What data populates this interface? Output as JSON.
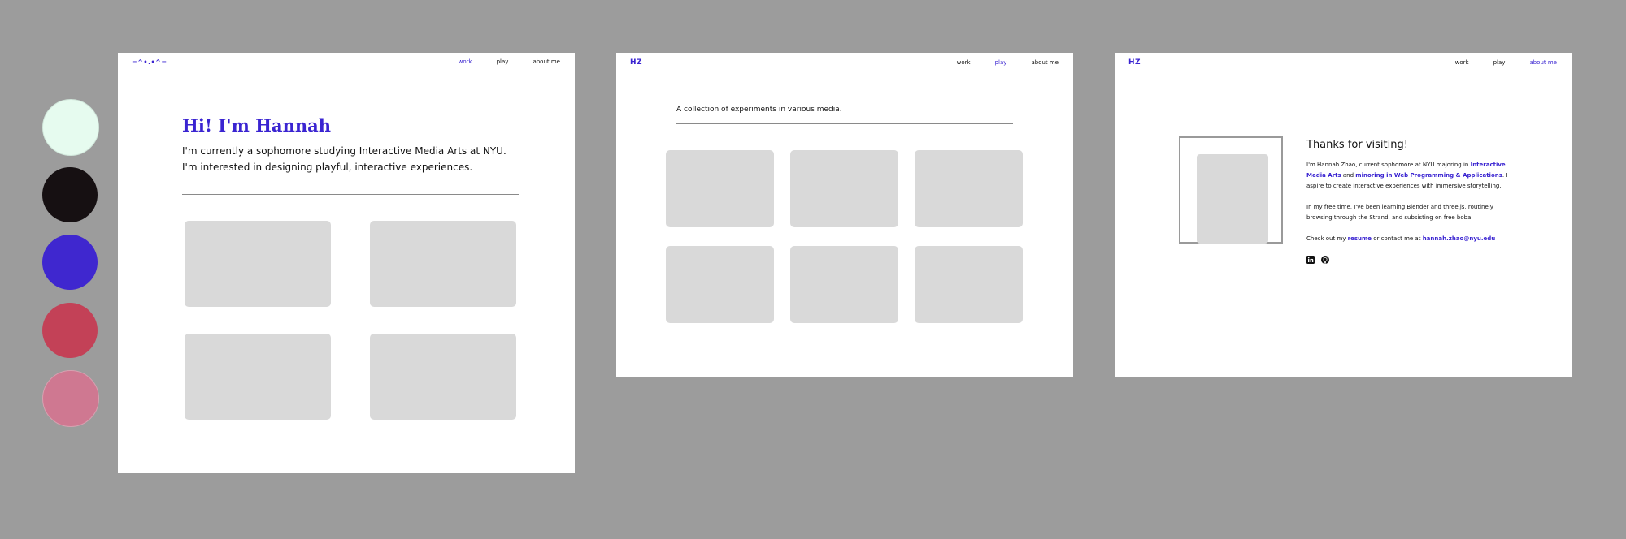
{
  "palette": {
    "colors": [
      "#e6fbef",
      "#161012",
      "#3f27cf",
      "#c34157",
      "#cf7891"
    ]
  },
  "frame1": {
    "logo": "=^•.•^=",
    "nav": [
      "work",
      "play",
      "about me"
    ],
    "active_nav": "work",
    "heading": "Hi! I'm Hannah",
    "intro": "I'm currently a sophomore studying Interactive Media Arts at NYU. I'm interested in designing playful, interactive experiences."
  },
  "frame2": {
    "logo": "HZ",
    "nav": [
      "work",
      "play",
      "about me"
    ],
    "active_nav": "play",
    "subtitle": "A collection of experiments in various media."
  },
  "frame3": {
    "logo": "HZ",
    "nav": [
      "work",
      "play",
      "about me"
    ],
    "active_nav": "about me",
    "title": "Thanks for visiting!",
    "p1_a": "I'm Hannah Zhao, current sophomore at NYU majoring in ",
    "p1_link1": "Interactive Media Arts",
    "p1_b": " and ",
    "p1_link2": "minoring in Web Programming & Applications",
    "p1_c": ". I aspire to create interactive experiences with immersive storytelling.",
    "p2": "In my free time, I've been learning Blender and three.js, routinely browsing through the Strand, and subsisting on free boba.",
    "p3_a": "Check out my ",
    "p3_link1": "resume",
    "p3_b": " or contact me at ",
    "p3_link2": "hannah.zhao@nyu.edu",
    "icons": [
      "linkedin-icon",
      "github-icon"
    ]
  }
}
